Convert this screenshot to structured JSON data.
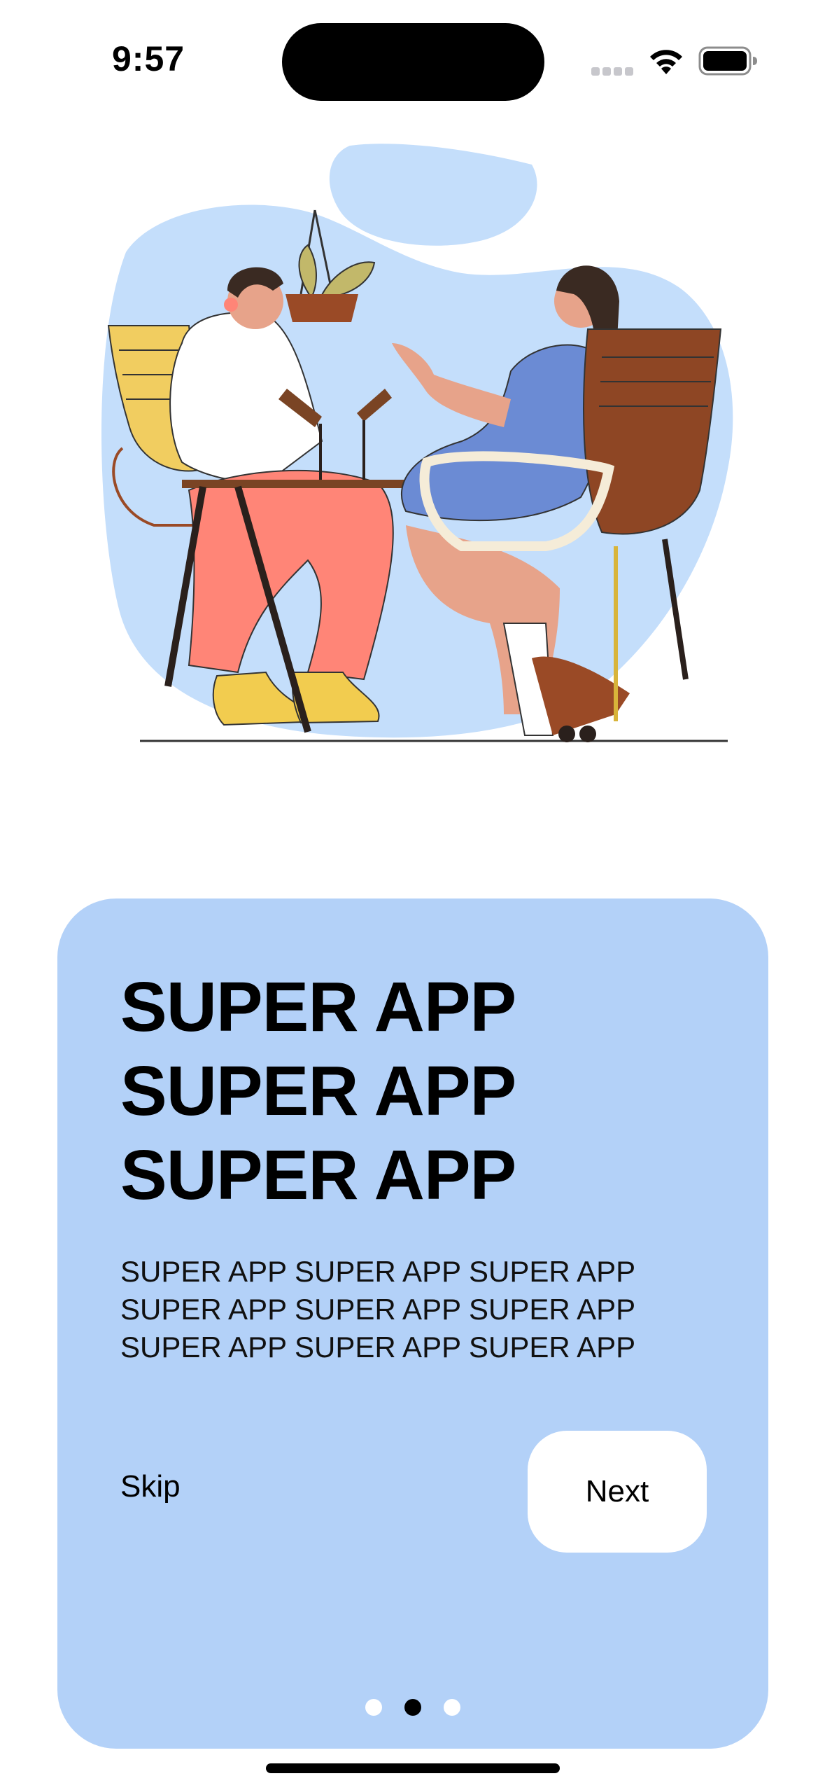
{
  "status_bar": {
    "time": "9:57",
    "icons": [
      "cellular-signal-icon",
      "wifi-icon",
      "battery-icon"
    ]
  },
  "illustration": {
    "description_icon": "podcast-illustration"
  },
  "onboarding": {
    "headline_lines": [
      "SUPER APP",
      "SUPER APP",
      "SUPER APP"
    ],
    "body_lines": [
      "SUPER APP SUPER APP SUPER APP",
      "SUPER APP SUPER APP SUPER APP",
      "SUPER APP SUPER APP SUPER APP"
    ],
    "skip_label": "Skip",
    "next_label": "Next",
    "page_count": 3,
    "current_page": 2
  },
  "colors": {
    "card_background": "#b3d1f8",
    "illustration_blob": "#c4defb",
    "button_background": "#ffffff",
    "active_dot": "#000000",
    "inactive_dot": "#ffffff"
  }
}
